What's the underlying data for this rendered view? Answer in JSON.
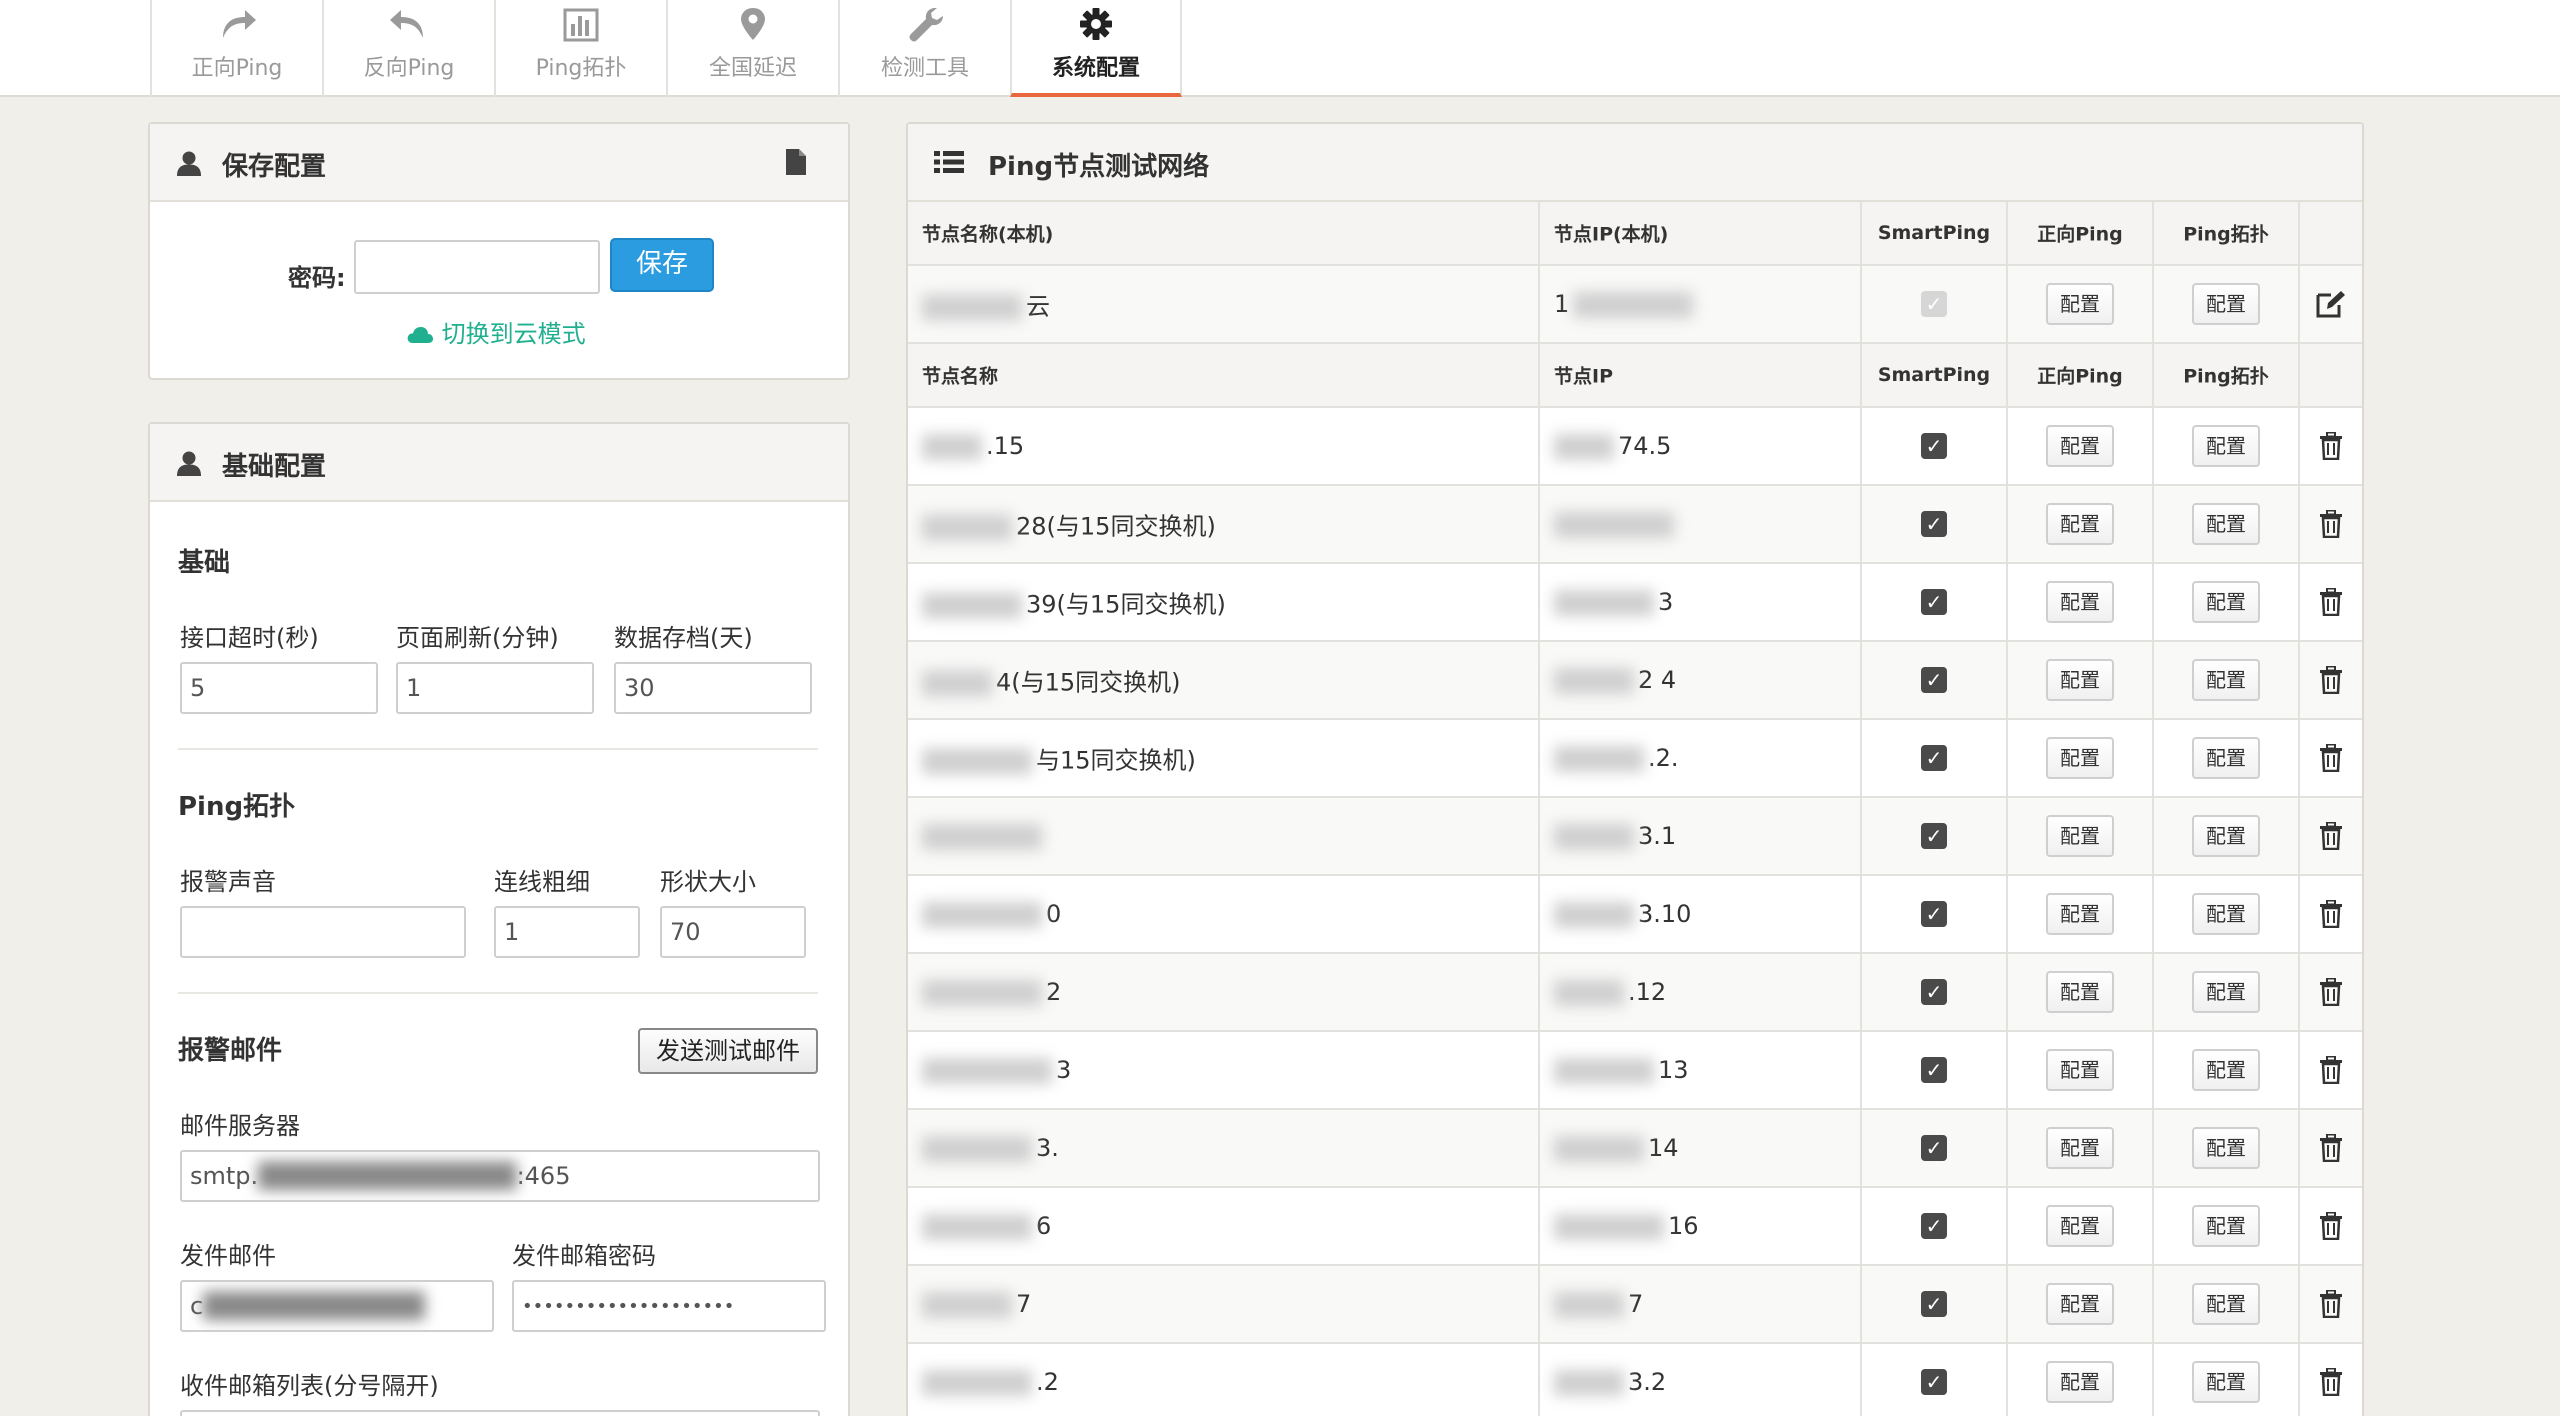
{
  "nav": {
    "tabs": [
      {
        "label": "正向Ping",
        "icon": "forward-arrow-icon",
        "active": false
      },
      {
        "label": "反向Ping",
        "icon": "reply-arrow-icon",
        "active": false
      },
      {
        "label": "Ping拓扑",
        "icon": "bar-chart-icon",
        "active": false
      },
      {
        "label": "全国延迟",
        "icon": "map-pin-icon",
        "active": false
      },
      {
        "label": "检测工具",
        "icon": "wrench-icon",
        "active": false
      },
      {
        "label": "系统配置",
        "icon": "gear-icon",
        "active": true
      }
    ]
  },
  "save_panel": {
    "title": "保存配置",
    "password_label": "密码:",
    "password_value": "",
    "save_button": "保存",
    "cloud_link": "切换到云模式",
    "colors": {
      "link": "#21b08f",
      "button": "#2b9ce0"
    }
  },
  "basic_panel": {
    "title": "基础配置",
    "basic": {
      "title": "基础",
      "timeout_label": "接口超时(秒)",
      "timeout_value": "5",
      "refresh_label": "页面刷新(分钟)",
      "refresh_value": "1",
      "archive_label": "数据存档(天)",
      "archive_value": "30"
    },
    "topology": {
      "title": "Ping拓扑",
      "alarm_sound_label": "报警声音",
      "alarm_sound_value": "",
      "line_width_label": "连线粗细",
      "line_width_value": "1",
      "shape_size_label": "形状大小",
      "shape_size_value": "70"
    },
    "mail": {
      "title": "报警邮件",
      "test_button": "发送测试邮件",
      "server_label": "邮件服务器",
      "server_prefix": "smtp.",
      "server_suffix": ":465",
      "sender_label": "发件邮件",
      "sender_prefix": "c",
      "sender_password_label": "发件邮箱密码",
      "sender_password_value": "••••••••••••••••••••",
      "recipients_label": "收件邮箱列表(分号隔开)"
    }
  },
  "network_panel": {
    "title": "Ping节点测试网络",
    "local_headers": [
      "节点名称(本机)",
      "节点IP(本机)",
      "SmartPing",
      "正向Ping",
      "Ping拓扑"
    ],
    "node_headers": [
      "节点名称",
      "节点IP",
      "SmartPing",
      "正向Ping",
      "Ping拓扑"
    ],
    "config_label": "配置",
    "local_node": {
      "name": "云",
      "ip": "1"
    },
    "nodes": [
      {
        "name": ".15",
        "ip": "74.5"
      },
      {
        "name": "28(与15同交换机)",
        "ip": ""
      },
      {
        "name": "39(与15同交换机)",
        "ip": "3"
      },
      {
        "name": "4(与15同交换机)",
        "ip": "2  4"
      },
      {
        "name": "与15同交换机)",
        "ip": ".2."
      },
      {
        "name": "",
        "ip": "3.1"
      },
      {
        "name": "0",
        "ip": "3.10"
      },
      {
        "name": "2",
        "ip": ".12"
      },
      {
        "name": "3",
        "ip": "13"
      },
      {
        "name": "3.",
        "ip": "14"
      },
      {
        "name": "6",
        "ip": "16"
      },
      {
        "name": "7",
        "ip": "7"
      },
      {
        "name": ".2",
        "ip": "3.2"
      }
    ]
  }
}
